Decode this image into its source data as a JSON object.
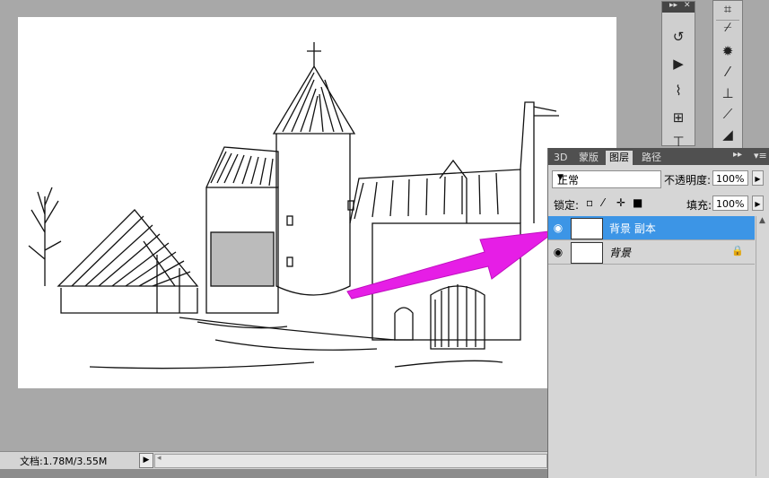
{
  "status": {
    "doc_info": "文档:1.78M/3.55M",
    "arrow": "▶",
    "scroll_left": "◂"
  },
  "tools_left": [
    "history-icon",
    "actions-icon",
    "brush-preset-icon",
    "clone-source-icon",
    "tool-preset-icon"
  ],
  "tools_right": [
    "crop-icon",
    "eyedropper-icon",
    "healing-icon",
    "brush-icon",
    "stamp-icon",
    "history-brush-icon",
    "eraser-icon"
  ],
  "layers_panel": {
    "tabs": [
      "3D",
      "蒙版",
      "图层",
      "路径"
    ],
    "active_tab": "图层",
    "collapse": "▸▸",
    "menu": "▾≡",
    "blend_mode": "正常",
    "opacity_label": "不透明度:",
    "opacity_value": "100%",
    "lock_label": "锁定:",
    "fill_label": "填充:",
    "fill_value": "100%",
    "layers": [
      {
        "name": "背景 副本",
        "selected": true,
        "locked": false
      },
      {
        "name": "背景",
        "selected": false,
        "locked": true
      }
    ]
  },
  "colors": {
    "selection": "#3c95e6",
    "arrow": "#e61ee6",
    "workspace": "#a8a8a8"
  }
}
